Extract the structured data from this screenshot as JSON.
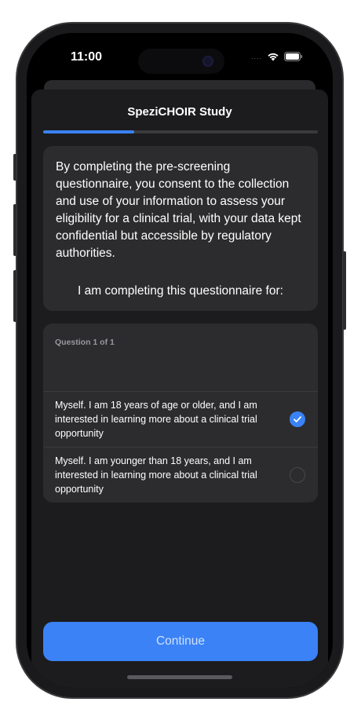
{
  "status_bar": {
    "time": "11:00",
    "cell_dots": "....",
    "icons": [
      "wifi-icon",
      "battery-icon"
    ]
  },
  "nav": {
    "title": "SpeziCHOIR Study"
  },
  "progress": {
    "fraction": 0.33,
    "color": "#3a82f6"
  },
  "intro": {
    "body": "By completing the pre-screening questionnaire, you consent to the collection and use of your information to assess your eligibility for a clinical trial, with your data kept confidential but accessible by regulatory authorities.",
    "prompt": "I am completing this questionnaire for:"
  },
  "question": {
    "counter": "Question 1 of 1",
    "options": [
      {
        "label": "Myself. I am 18 years of age or older, and I am interested in learning more about a clinical trial opportunity",
        "selected": true
      },
      {
        "label": "Myself. I am younger than 18 years, and I am interested in learning more about a clinical trial opportunity",
        "selected": false
      }
    ]
  },
  "footer": {
    "continue_label": "Continue"
  },
  "colors": {
    "accent": "#3a82f6",
    "card": "#2c2c2e",
    "sheet": "#1c1c1e"
  }
}
